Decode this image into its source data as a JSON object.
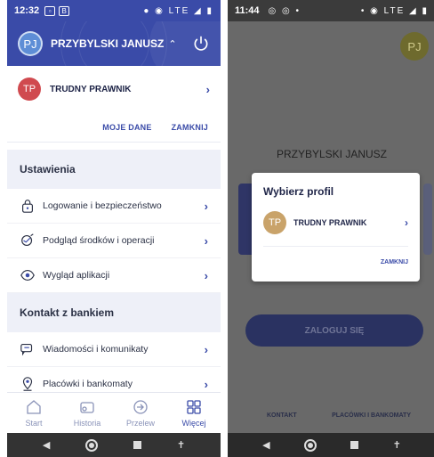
{
  "left": {
    "status": {
      "time": "12:32",
      "icons": "LTE"
    },
    "header": {
      "avatar": "PJ",
      "name": "PRZYBYLSKI JANUSZ"
    },
    "profile": {
      "avatar": "TP",
      "name": "TRUDNY PRAWNIK"
    },
    "actions": {
      "my_data": "MOJE DANE",
      "close": "ZAMKNIJ"
    },
    "sections": [
      {
        "title": "Ustawienia",
        "items": [
          {
            "label": "Logowanie i bezpieczeństwo",
            "icon": "lock-icon"
          },
          {
            "label": "Podgląd środków i operacji",
            "icon": "eye-preview-icon"
          },
          {
            "label": "Wygląd aplikacji",
            "icon": "eye-icon"
          }
        ]
      },
      {
        "title": "Kontakt z bankiem",
        "items": [
          {
            "label": "Wiadomości i komunikaty",
            "icon": "messages-icon"
          },
          {
            "label": "Placówki i bankomaty",
            "icon": "location-pin-icon"
          }
        ]
      }
    ],
    "bottom_nav": [
      {
        "label": "Start",
        "icon": "home-icon",
        "active": false
      },
      {
        "label": "Historia",
        "icon": "history-icon",
        "active": false
      },
      {
        "label": "Przelew",
        "icon": "transfer-icon",
        "active": false
      },
      {
        "label": "Więcej",
        "icon": "grid-icon",
        "active": true
      }
    ]
  },
  "right": {
    "status": {
      "time": "11:44",
      "icons": "LTE"
    },
    "avatar": "PJ",
    "user_name": "PRZYBYLSKI JANUSZ",
    "login_button": "ZALOGUJ SIĘ",
    "footer": {
      "contact": "KONTAKT",
      "branches": "PLACÓWKI I BANKOMATY"
    },
    "modal": {
      "title": "Wybierz profil",
      "profile_avatar": "TP",
      "profile_name": "TRUDNY PRAWNIK",
      "close": "ZAMKNIJ"
    }
  },
  "colors": {
    "brand": "#3a4ba8",
    "section_bg": "#eef0f8",
    "tp_avatar": "#d04a4f"
  }
}
